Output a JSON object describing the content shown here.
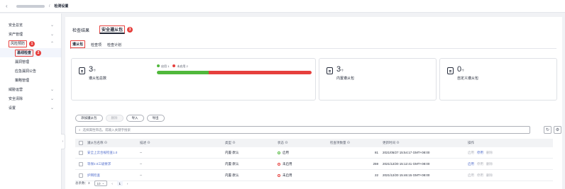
{
  "topbar": {
    "back_icon": "chevron-left-icon",
    "crumb_current": "检测设置"
  },
  "sidebar": {
    "items": [
      {
        "label": "安全总览",
        "chevron": "⌄"
      },
      {
        "label": "资产管理",
        "chevron": "⌄"
      },
      {
        "label": "风险预防",
        "chevron": "⌃",
        "badge": "1"
      },
      {
        "label": "基线检查",
        "sub": true,
        "badge": "2"
      },
      {
        "label": "漏洞管理",
        "sub": true
      },
      {
        "label": "应急漏洞公告",
        "sub": true
      },
      {
        "label": "策略管理",
        "sub": true
      },
      {
        "label": "威胁运营",
        "chevron": "⌄"
      },
      {
        "label": "安全清除",
        "chevron": "⌄"
      },
      {
        "label": "设置",
        "chevron": "⌄"
      }
    ]
  },
  "tabs_top": {
    "tab1": "检查结果",
    "tab2": "安全遵从包",
    "badge": "3"
  },
  "tabs_sub": {
    "tab1": "遵从包",
    "tab2": "检查项",
    "tab3": "检查计划"
  },
  "cards": {
    "total": {
      "num": "3",
      "unit": "个",
      "label": "遵从包总数"
    },
    "builtin": {
      "num": "3",
      "unit": "个",
      "label": "内置遵从包"
    },
    "custom": {
      "num": "0",
      "unit": "个",
      "label": "自定义遵从包"
    },
    "legend": {
      "enabled_label": "启用",
      "enabled_count": "1",
      "disabled_label": "未启用",
      "disabled_count": "2"
    }
  },
  "progress": {
    "enabled": 1,
    "disabled": 2
  },
  "colors": {
    "green": "#50b83c",
    "red": "#e6403d",
    "accent": "#526ecc"
  },
  "buttons": {
    "add": "添加遵从包",
    "delete": "删除",
    "import": "导入",
    "export": "导出"
  },
  "search": {
    "placeholder": "选择属性筛选，或输入关键字搜索",
    "icon": "search-icon",
    "refresh_icon": "refresh-icon",
    "settings_icon": "gear-icon"
  },
  "table": {
    "headers": [
      "遵从包名称 ⊖",
      "描述 ⊖",
      "类型 ⊖",
      "状态 ⊖",
      "检查项数量 ⊖",
      "更新时间 ⊖",
      "操作"
    ],
    "rows": [
      {
        "name": "安全上云合规检查1.0",
        "desc": "--",
        "type": "内置-默认",
        "status": "启用",
        "status_color": "#50b83c",
        "count": "81",
        "time": "2021/05/27 15:54:17 GMT+08:00",
        "ops": [
          "启用",
          "停用",
          "删除"
        ]
      },
      {
        "name": "等保2.0三级要求",
        "desc": "--",
        "type": "内置-默认",
        "status": "未启用",
        "status_color": "#e6403d",
        "count": "259",
        "time": "2021/12/20 15:12:41 GMT+08:00",
        "ops": [
          "启用",
          "停用",
          "删除"
        ]
      },
      {
        "name": "护网检查",
        "desc": "--",
        "type": "内置-默认",
        "status": "未启用",
        "status_color": "#e6403d",
        "count": "22",
        "time": "2021/12/20 15:46:15 GMT+08:00",
        "ops": [
          "启用",
          "停用",
          "删除"
        ]
      }
    ]
  },
  "pager": {
    "total": "总条数：3",
    "size": "10",
    "page": "1"
  }
}
